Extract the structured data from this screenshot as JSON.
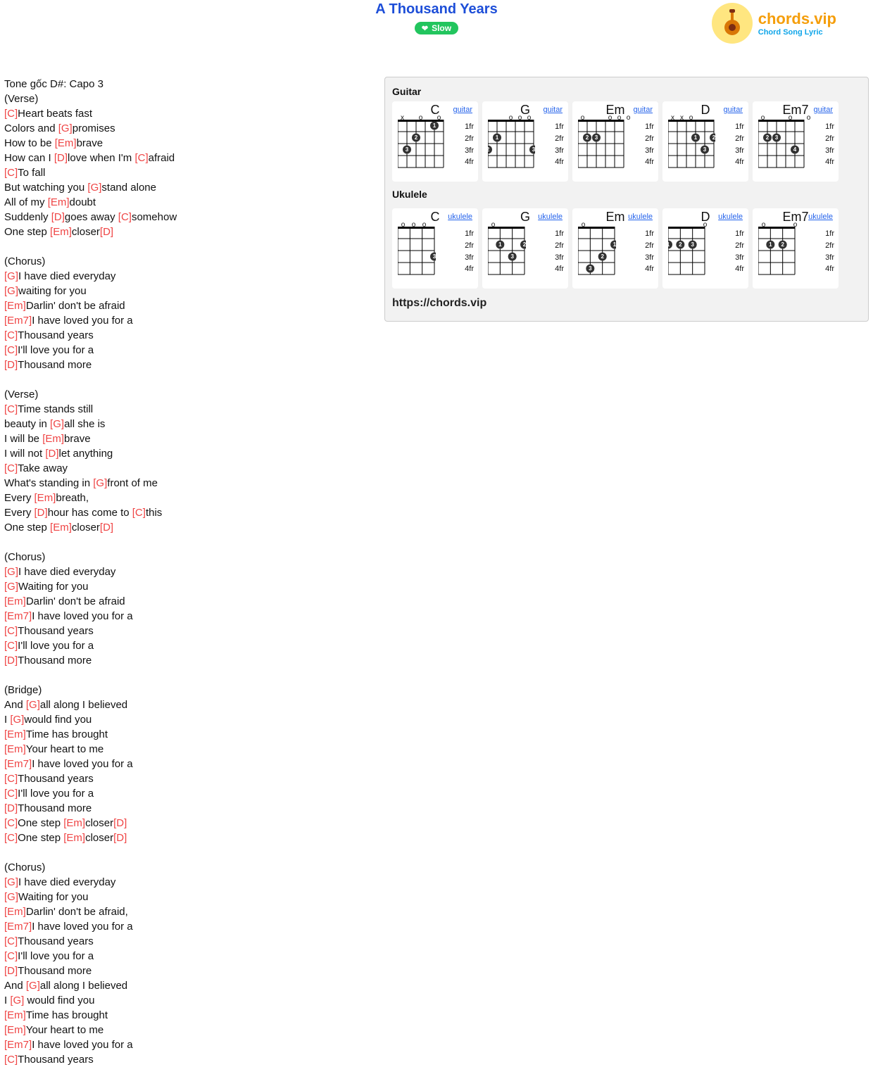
{
  "title": "A Thousand Years",
  "slow_label": "Slow",
  "logo": {
    "main": "chords.vip",
    "sub": "Chord Song Lyric"
  },
  "url_label": "https://chords.vip",
  "intro": "Tone gốc D#: Capo 3",
  "sections": {
    "verse1_label": "(Verse)",
    "chorus_label": "(Chorus)",
    "verse2_label": "(Verse)",
    "bridge_label": "(Bridge)"
  },
  "instruments": {
    "guitar": "Guitar",
    "ukulele": "Ukulele",
    "guitar_link": "guitar",
    "ukulele_link": "ukulele"
  },
  "chords": {
    "C": "C",
    "G": "G",
    "Em": "Em",
    "D": "D",
    "Em7": "Em7"
  },
  "frets": {
    "f1": "1fr",
    "f2": "2fr",
    "f3": "3fr",
    "f4": "4fr"
  },
  "lyrics": [
    {
      "t": "raw",
      "v": "Tone gốc D#: Capo 3"
    },
    {
      "t": "raw",
      "v": "(Verse)"
    },
    {
      "t": "mix",
      "p": [
        [
          "[C]",
          "c"
        ],
        [
          "Heart beats fast",
          ""
        ]
      ]
    },
    {
      "t": "mix",
      "p": [
        [
          "Colors and ",
          ""
        ],
        [
          "[G]",
          "c"
        ],
        [
          "promises",
          ""
        ]
      ]
    },
    {
      "t": "mix",
      "p": [
        [
          "How to be ",
          ""
        ],
        [
          "[Em]",
          "c"
        ],
        [
          "brave",
          ""
        ]
      ]
    },
    {
      "t": "mix",
      "p": [
        [
          "How can I ",
          ""
        ],
        [
          "[D]",
          "c"
        ],
        [
          "love when I'm ",
          ""
        ],
        [
          "[C]",
          "c"
        ],
        [
          "afraid",
          ""
        ]
      ]
    },
    {
      "t": "mix",
      "p": [
        [
          "[C]",
          "c"
        ],
        [
          "To fall",
          ""
        ]
      ]
    },
    {
      "t": "mix",
      "p": [
        [
          "But watching you ",
          ""
        ],
        [
          "[G]",
          "c"
        ],
        [
          "stand alone",
          ""
        ]
      ]
    },
    {
      "t": "mix",
      "p": [
        [
          "All of my ",
          ""
        ],
        [
          "[Em]",
          "c"
        ],
        [
          "doubt",
          ""
        ]
      ]
    },
    {
      "t": "mix",
      "p": [
        [
          "Suddenly ",
          ""
        ],
        [
          "[D]",
          "c"
        ],
        [
          "goes away ",
          ""
        ],
        [
          "[C]",
          "c"
        ],
        [
          "somehow",
          ""
        ]
      ]
    },
    {
      "t": "mix",
      "p": [
        [
          "One step ",
          ""
        ],
        [
          "[Em]",
          "c"
        ],
        [
          "closer",
          ""
        ],
        [
          "[D]",
          "c"
        ]
      ]
    },
    {
      "t": "raw",
      "v": ""
    },
    {
      "t": "raw",
      "v": "(Chorus)"
    },
    {
      "t": "mix",
      "p": [
        [
          "[G]",
          "c"
        ],
        [
          "I have died everyday",
          ""
        ]
      ]
    },
    {
      "t": "mix",
      "p": [
        [
          "[G]",
          "c"
        ],
        [
          "waiting for you",
          ""
        ]
      ]
    },
    {
      "t": "mix",
      "p": [
        [
          "[Em]",
          "c"
        ],
        [
          "Darlin' don't be afraid",
          ""
        ]
      ]
    },
    {
      "t": "mix",
      "p": [
        [
          "[Em7]",
          "c"
        ],
        [
          "I have loved you for a",
          ""
        ]
      ]
    },
    {
      "t": "mix",
      "p": [
        [
          "[C]",
          "c"
        ],
        [
          "Thousand years",
          ""
        ]
      ]
    },
    {
      "t": "mix",
      "p": [
        [
          "[C]",
          "c"
        ],
        [
          "I'll love you for a",
          ""
        ]
      ]
    },
    {
      "t": "mix",
      "p": [
        [
          "[D]",
          "c"
        ],
        [
          "Thousand more",
          ""
        ]
      ]
    },
    {
      "t": "raw",
      "v": ""
    },
    {
      "t": "raw",
      "v": "(Verse)"
    },
    {
      "t": "mix",
      "p": [
        [
          "[C]",
          "c"
        ],
        [
          "Time stands still",
          ""
        ]
      ]
    },
    {
      "t": "mix",
      "p": [
        [
          "beauty in ",
          ""
        ],
        [
          "[G]",
          "c"
        ],
        [
          "all she is",
          ""
        ]
      ]
    },
    {
      "t": "mix",
      "p": [
        [
          "I will be ",
          ""
        ],
        [
          "[Em]",
          "c"
        ],
        [
          "brave",
          ""
        ]
      ]
    },
    {
      "t": "mix",
      "p": [
        [
          "I will not ",
          ""
        ],
        [
          "[D]",
          "c"
        ],
        [
          "let anything",
          ""
        ]
      ]
    },
    {
      "t": "mix",
      "p": [
        [
          "[C]",
          "c"
        ],
        [
          "Take away",
          ""
        ]
      ]
    },
    {
      "t": "mix",
      "p": [
        [
          "What's standing in ",
          ""
        ],
        [
          "[G]",
          "c"
        ],
        [
          "front of me",
          ""
        ]
      ]
    },
    {
      "t": "mix",
      "p": [
        [
          "Every ",
          ""
        ],
        [
          "[Em]",
          "c"
        ],
        [
          "breath,",
          ""
        ]
      ]
    },
    {
      "t": "mix",
      "p": [
        [
          "Every ",
          ""
        ],
        [
          "[D]",
          "c"
        ],
        [
          "hour has come to ",
          ""
        ],
        [
          "[C]",
          "c"
        ],
        [
          "this",
          ""
        ]
      ]
    },
    {
      "t": "mix",
      "p": [
        [
          "One step ",
          ""
        ],
        [
          "[Em]",
          "c"
        ],
        [
          "closer",
          ""
        ],
        [
          "[D]",
          "c"
        ]
      ]
    },
    {
      "t": "raw",
      "v": ""
    },
    {
      "t": "raw",
      "v": "(Chorus)"
    },
    {
      "t": "mix",
      "p": [
        [
          "[G]",
          "c"
        ],
        [
          "I have died everyday",
          ""
        ]
      ]
    },
    {
      "t": "mix",
      "p": [
        [
          "[G]",
          "c"
        ],
        [
          "Waiting for you",
          ""
        ]
      ]
    },
    {
      "t": "mix",
      "p": [
        [
          "[Em]",
          "c"
        ],
        [
          "Darlin' don't be afraid",
          ""
        ]
      ]
    },
    {
      "t": "mix",
      "p": [
        [
          "[Em7]",
          "c"
        ],
        [
          "I have loved you for a",
          ""
        ]
      ]
    },
    {
      "t": "mix",
      "p": [
        [
          "[C]",
          "c"
        ],
        [
          "Thousand years",
          ""
        ]
      ]
    },
    {
      "t": "mix",
      "p": [
        [
          "[C]",
          "c"
        ],
        [
          "I'll love you for a",
          ""
        ]
      ]
    },
    {
      "t": "mix",
      "p": [
        [
          "[D]",
          "c"
        ],
        [
          "Thousand more",
          ""
        ]
      ]
    },
    {
      "t": "raw",
      "v": ""
    },
    {
      "t": "raw",
      "v": "(Bridge)"
    },
    {
      "t": "mix",
      "p": [
        [
          "And ",
          ""
        ],
        [
          "[G]",
          "c"
        ],
        [
          "all along I believed",
          ""
        ]
      ]
    },
    {
      "t": "mix",
      "p": [
        [
          "I ",
          ""
        ],
        [
          "[G]",
          "c"
        ],
        [
          "would find you",
          ""
        ]
      ]
    },
    {
      "t": "mix",
      "p": [
        [
          "[Em]",
          "c"
        ],
        [
          "Time has brought",
          ""
        ]
      ]
    },
    {
      "t": "mix",
      "p": [
        [
          "[Em]",
          "c"
        ],
        [
          "Your heart to me",
          ""
        ]
      ]
    },
    {
      "t": "mix",
      "p": [
        [
          "[Em7]",
          "c"
        ],
        [
          "I have loved you for a",
          ""
        ]
      ]
    },
    {
      "t": "mix",
      "p": [
        [
          "[C]",
          "c"
        ],
        [
          "Thousand years",
          ""
        ]
      ]
    },
    {
      "t": "mix",
      "p": [
        [
          "[C]",
          "c"
        ],
        [
          "I'll love you for a",
          ""
        ]
      ]
    },
    {
      "t": "mix",
      "p": [
        [
          "[D]",
          "c"
        ],
        [
          "Thousand more",
          ""
        ]
      ]
    },
    {
      "t": "mix",
      "p": [
        [
          "[C]",
          "c"
        ],
        [
          "One step ",
          ""
        ],
        [
          "[Em]",
          "c"
        ],
        [
          "closer",
          ""
        ],
        [
          "[D]",
          "c"
        ]
      ]
    },
    {
      "t": "mix",
      "p": [
        [
          "[C]",
          "c"
        ],
        [
          "One step ",
          ""
        ],
        [
          "[Em]",
          "c"
        ],
        [
          "closer",
          ""
        ],
        [
          "[D]",
          "c"
        ]
      ]
    },
    {
      "t": "raw",
      "v": ""
    },
    {
      "t": "raw",
      "v": "(Chorus)"
    },
    {
      "t": "mix",
      "p": [
        [
          "[G]",
          "c"
        ],
        [
          "I have died everyday",
          ""
        ]
      ]
    },
    {
      "t": "mix",
      "p": [
        [
          "[G]",
          "c"
        ],
        [
          "Waiting for you",
          ""
        ]
      ]
    },
    {
      "t": "mix",
      "p": [
        [
          "[Em]",
          "c"
        ],
        [
          "Darlin' don't be afraid,",
          ""
        ]
      ]
    },
    {
      "t": "mix",
      "p": [
        [
          "[Em7]",
          "c"
        ],
        [
          "I have loved you for a",
          ""
        ]
      ]
    },
    {
      "t": "mix",
      "p": [
        [
          "[C]",
          "c"
        ],
        [
          "Thousand years",
          ""
        ]
      ]
    },
    {
      "t": "mix",
      "p": [
        [
          "[C]",
          "c"
        ],
        [
          "I'll love you for a",
          ""
        ]
      ]
    },
    {
      "t": "mix",
      "p": [
        [
          "[D]",
          "c"
        ],
        [
          "Thousand more",
          ""
        ]
      ]
    },
    {
      "t": "mix",
      "p": [
        [
          "And ",
          ""
        ],
        [
          "[G]",
          "c"
        ],
        [
          "all along I believed",
          ""
        ]
      ]
    },
    {
      "t": "mix",
      "p": [
        [
          "I ",
          ""
        ],
        [
          "[G]",
          "c"
        ],
        [
          " would find you",
          ""
        ]
      ]
    },
    {
      "t": "mix",
      "p": [
        [
          "[Em]",
          "c"
        ],
        [
          "Time has brought",
          ""
        ]
      ]
    },
    {
      "t": "mix",
      "p": [
        [
          "[Em]",
          "c"
        ],
        [
          "Your heart to me",
          ""
        ]
      ]
    },
    {
      "t": "mix",
      "p": [
        [
          "[Em7]",
          "c"
        ],
        [
          "I have loved you for a",
          ""
        ]
      ]
    },
    {
      "t": "mix",
      "p": [
        [
          "[C]",
          "c"
        ],
        [
          "Thousand years",
          ""
        ]
      ]
    }
  ],
  "guitar_diagrams": [
    {
      "name": "C",
      "open": [
        "x",
        "",
        "o",
        "",
        "o",
        ""
      ],
      "dots": [
        {
          "s": 2,
          "f": 1,
          "n": "1"
        },
        {
          "s": 4,
          "f": 2,
          "n": "2"
        },
        {
          "s": 5,
          "f": 3,
          "n": "3"
        }
      ]
    },
    {
      "name": "G",
      "open": [
        "",
        "",
        "o",
        "o",
        "o",
        ""
      ],
      "dots": [
        {
          "s": 5,
          "f": 2,
          "n": "1"
        },
        {
          "s": 6,
          "f": 3,
          "n": "2"
        },
        {
          "s": 1,
          "f": 3,
          "n": "3"
        }
      ]
    },
    {
      "name": "Em",
      "open": [
        "o",
        "",
        "",
        "o",
        "o",
        "o"
      ],
      "dots": [
        {
          "s": 5,
          "f": 2,
          "n": "2"
        },
        {
          "s": 4,
          "f": 2,
          "n": "3"
        }
      ]
    },
    {
      "name": "D",
      "open": [
        "x",
        "x",
        "o",
        "",
        "",
        ""
      ],
      "dots": [
        {
          "s": 3,
          "f": 2,
          "n": "1"
        },
        {
          "s": 1,
          "f": 2,
          "n": "2"
        },
        {
          "s": 2,
          "f": 3,
          "n": "3"
        }
      ]
    },
    {
      "name": "Em7",
      "open": [
        "o",
        "",
        "",
        "o",
        "",
        "o"
      ],
      "dots": [
        {
          "s": 5,
          "f": 2,
          "n": "2"
        },
        {
          "s": 4,
          "f": 2,
          "n": "3"
        },
        {
          "s": 2,
          "f": 3,
          "n": "4"
        }
      ]
    }
  ],
  "ukulele_diagrams": [
    {
      "name": "C",
      "open": [
        "o",
        "o",
        "o",
        ""
      ],
      "dots": [
        {
          "s": 1,
          "f": 3,
          "n": "3"
        }
      ]
    },
    {
      "name": "G",
      "open": [
        "o",
        "",
        "",
        ""
      ],
      "dots": [
        {
          "s": 3,
          "f": 2,
          "n": "1"
        },
        {
          "s": 1,
          "f": 2,
          "n": "2"
        },
        {
          "s": 2,
          "f": 3,
          "n": "3"
        }
      ]
    },
    {
      "name": "Em",
      "open": [
        "o",
        "",
        "",
        ""
      ],
      "dots": [
        {
          "s": 1,
          "f": 2,
          "n": "1"
        },
        {
          "s": 2,
          "f": 3,
          "n": "2"
        },
        {
          "s": 3,
          "f": 4,
          "n": "3"
        }
      ]
    },
    {
      "name": "D",
      "open": [
        "",
        "",
        "",
        "o"
      ],
      "dots": [
        {
          "s": 4,
          "f": 2,
          "n": "1"
        },
        {
          "s": 3,
          "f": 2,
          "n": "2"
        },
        {
          "s": 2,
          "f": 2,
          "n": "3"
        }
      ]
    },
    {
      "name": "Em7",
      "open": [
        "o",
        "",
        "",
        "o"
      ],
      "dots": [
        {
          "s": 3,
          "f": 2,
          "n": "1"
        },
        {
          "s": 2,
          "f": 2,
          "n": "2"
        }
      ]
    }
  ]
}
